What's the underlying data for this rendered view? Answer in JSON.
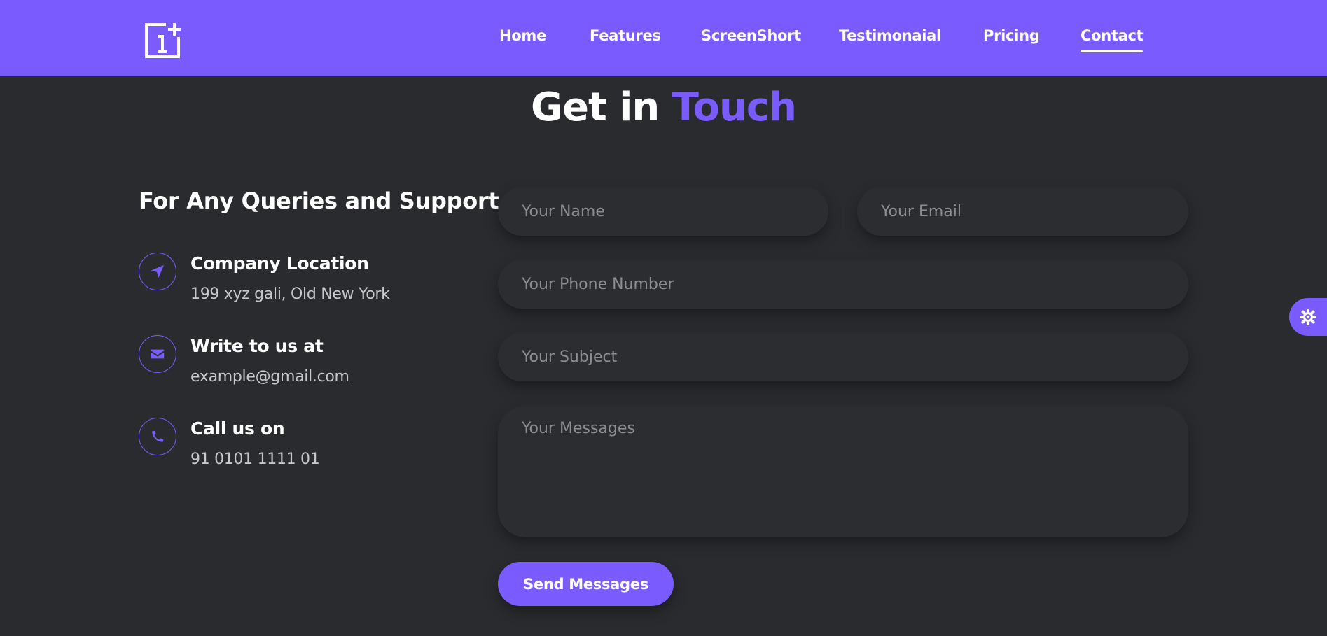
{
  "colors": {
    "accent": "#7a5cfe",
    "background": "#2a2b2f",
    "field": "#2c2d31"
  },
  "navbar": {
    "logo": "1+",
    "items": [
      {
        "label": "Home"
      },
      {
        "label": "Features"
      },
      {
        "label": "ScreenShort"
      },
      {
        "label": "Testimonaial"
      },
      {
        "label": "Pricing"
      },
      {
        "label": "Contact",
        "active": true
      }
    ]
  },
  "heading": {
    "part1": "Get in",
    "part2": "Touch"
  },
  "contact_info": {
    "title": "For Any Queries and Support",
    "items": [
      {
        "icon": "location-arrow-icon",
        "title": "Company Location",
        "text": "199 xyz gali, Old New York"
      },
      {
        "icon": "envelope-icon",
        "title": "Write to us at",
        "text": "example@gmail.com"
      },
      {
        "icon": "phone-icon",
        "title": "Call us on",
        "text": "91 0101 1111 01"
      }
    ]
  },
  "form": {
    "name_placeholder": "Your Name",
    "email_placeholder": "Your Email",
    "phone_placeholder": "Your Phone Number",
    "subject_placeholder": "Your Subject",
    "message_placeholder": "Your Messages",
    "submit_label": "Send Messages"
  },
  "theme_toggle": {
    "icon": "sun-gear-icon"
  }
}
